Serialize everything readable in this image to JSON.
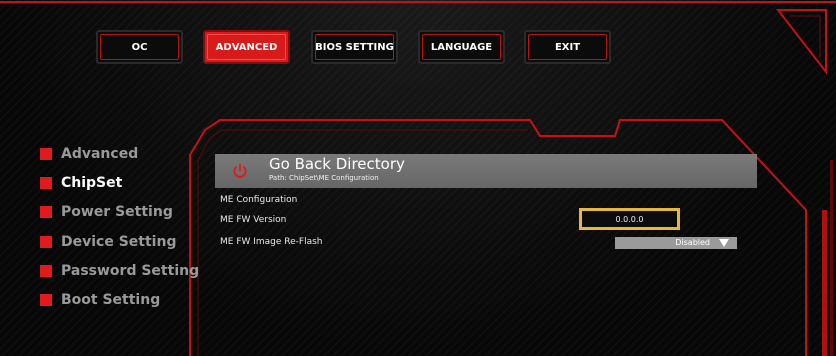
{
  "nav": {
    "tabs": [
      {
        "label": "OC",
        "active": false
      },
      {
        "label": "ADVANCED",
        "active": true
      },
      {
        "label": "BIOS SETTING",
        "active": false
      },
      {
        "label": "LANGUAGE",
        "active": false
      },
      {
        "label": "EXIT",
        "active": false
      }
    ]
  },
  "sidebar": {
    "items": [
      {
        "label": "Advanced",
        "active": false
      },
      {
        "label": "ChipSet",
        "active": true
      },
      {
        "label": "Power Setting",
        "active": false
      },
      {
        "label": "Device Setting",
        "active": false
      },
      {
        "label": "Password Setting",
        "active": false
      },
      {
        "label": "Boot Setting",
        "active": false
      }
    ]
  },
  "main": {
    "header": {
      "title": "Go Back Directory",
      "path": "Path: ChipSet\\ME Configuration",
      "icon": "power-icon"
    },
    "rows": [
      {
        "label": "ME Configuration"
      },
      {
        "label": "ME FW Version",
        "value": "0.0.0.0"
      },
      {
        "label": "ME FW Image Re-Flash",
        "value": "Disabled",
        "icon": "chevron-down-icon"
      }
    ]
  },
  "colors": {
    "accent": "#e01b1b",
    "highlight": "#e5b93a",
    "header_bg": "#707070"
  }
}
